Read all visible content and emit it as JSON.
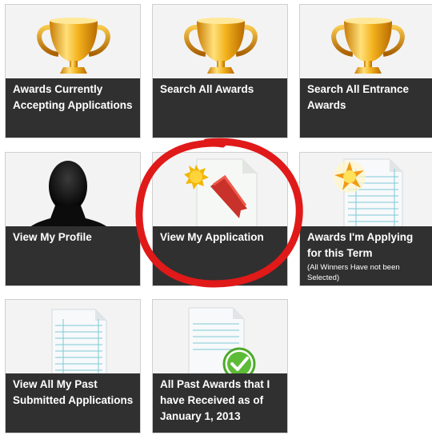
{
  "tiles": [
    {
      "title": "Awards Currently Accepting Applications",
      "icon": "trophy-icon"
    },
    {
      "title": "Search All Awards",
      "icon": "trophy-icon"
    },
    {
      "title": "Search All Entrance Awards",
      "icon": "trophy-icon"
    },
    {
      "title": "View My Profile",
      "icon": "person-silhouette-icon"
    },
    {
      "title": "View My Application",
      "icon": "document-ribbon-icon"
    },
    {
      "title": "Awards I'm Applying for this Term",
      "note": "(All Winners Have not been Selected)",
      "icon": "document-star-icon"
    },
    {
      "title": "View All My Past Submitted Applications",
      "icon": "lined-document-icon"
    },
    {
      "title": "All Past Awards that I have Received as of January 1, 2013",
      "icon": "document-checkmark-icon"
    }
  ],
  "colors": {
    "caption_bg": "#303030",
    "caption_text": "#ffffff",
    "highlight_circle": "#e01919",
    "check_green": "#4caa2a",
    "trophy_gold": "#e0a317"
  }
}
